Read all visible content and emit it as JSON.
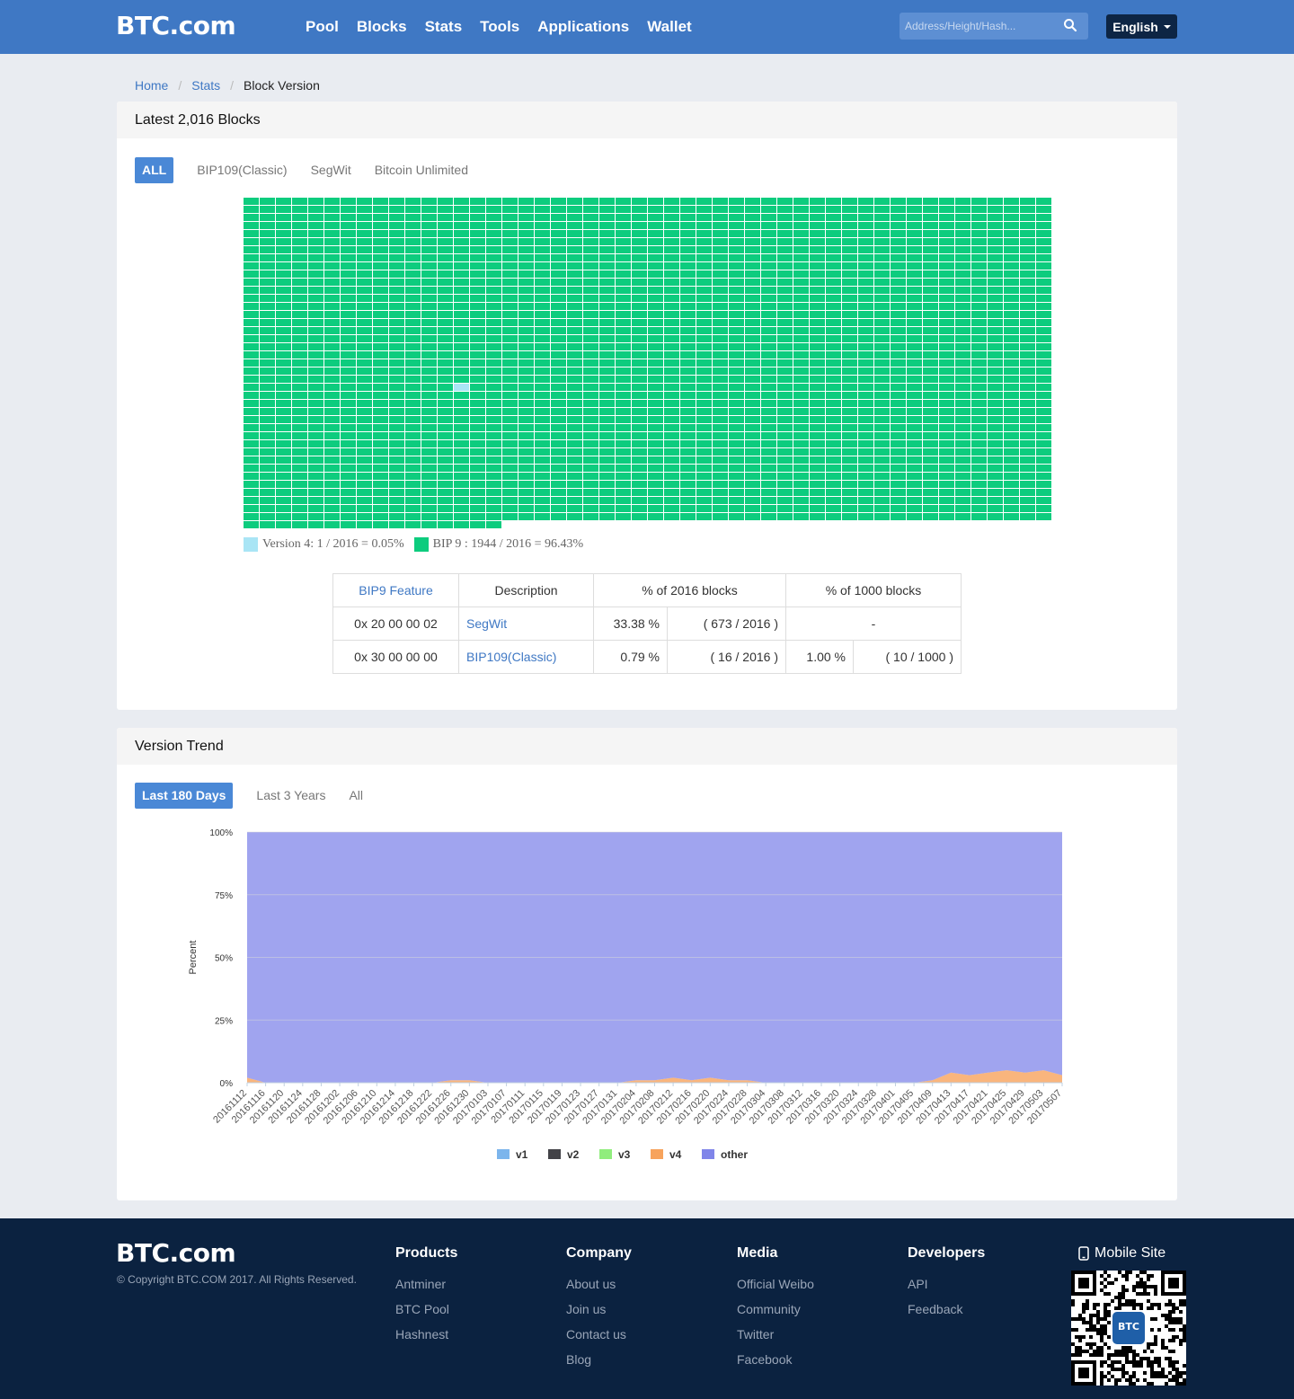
{
  "nav": {
    "logo": "BTC.com",
    "links": [
      "Pool",
      "Blocks",
      "Stats",
      "Tools",
      "Applications",
      "Wallet"
    ],
    "search_placeholder": "Address/Height/Hash...",
    "language": "English"
  },
  "breadcrumb": [
    "Home",
    "Stats",
    "Block Version"
  ],
  "blocks_panel": {
    "title": "Latest 2,016 Blocks",
    "tabs": [
      "ALL",
      "BIP109(Classic)",
      "SegWit",
      "Bitcoin Unlimited"
    ],
    "active_tab": "ALL",
    "legend": [
      {
        "label": "Version 4: 1 / 2016 = 0.05%",
        "color": "#a9e5f5"
      },
      {
        "label": "BIP 9 : 1944 / 2016 = 96.43%",
        "color": "#0dcc7e"
      }
    ],
    "grid_colors": {
      "bip9": "#0dcc7e",
      "v4": "#a9e5f5"
    },
    "table": {
      "headers": [
        "BIP9 Feature",
        "Description",
        "% of 2016 blocks",
        "% of 1000 blocks"
      ],
      "rows": [
        {
          "feature": "0x 20 00 00 02",
          "desc": "SegWit",
          "pct2016": "33.38 %",
          "cnt2016": "( 673 / 2016 )",
          "pct1000": "-",
          "cnt1000": ""
        },
        {
          "feature": "0x 30 00 00 00",
          "desc": "BIP109(Classic)",
          "pct2016": "0.79 %",
          "cnt2016": "( 16 / 2016 )",
          "pct1000": "1.00 %",
          "cnt1000": "( 10 / 1000 )"
        }
      ]
    }
  },
  "trend_panel": {
    "title": "Version Trend",
    "tabs": [
      "Last 180 Days",
      "Last 3 Years",
      "All"
    ],
    "active_tab": "Last 180 Days"
  },
  "chart_data": {
    "type": "area",
    "stacked": true,
    "ylabel": "Percent",
    "yticks": [
      "0%",
      "25%",
      "50%",
      "75%",
      "100%"
    ],
    "ylim": [
      0,
      100
    ],
    "x": [
      "20161112",
      "20161116",
      "20161120",
      "20161124",
      "20161128",
      "20161202",
      "20161206",
      "20161210",
      "20161214",
      "20161218",
      "20161222",
      "20161226",
      "20161230",
      "20170103",
      "20170107",
      "20170111",
      "20170115",
      "20170119",
      "20170123",
      "20170127",
      "20170131",
      "20170204",
      "20170208",
      "20170212",
      "20170216",
      "20170220",
      "20170224",
      "20170228",
      "20170304",
      "20170308",
      "20170312",
      "20170316",
      "20170320",
      "20170324",
      "20170328",
      "20170401",
      "20170405",
      "20170409",
      "20170413",
      "20170417",
      "20170421",
      "20170425",
      "20170429",
      "20170503",
      "20170507"
    ],
    "series": [
      {
        "name": "v1",
        "color": "#7cb5ec",
        "values": [
          0,
          0,
          0,
          0,
          0,
          0,
          0,
          0,
          0,
          0,
          0,
          0,
          0,
          0,
          0,
          0,
          0,
          0,
          0,
          0,
          0,
          0,
          0,
          0,
          0,
          0,
          0,
          0,
          0,
          0,
          0,
          0,
          0,
          0,
          0,
          0,
          0,
          0,
          0,
          0,
          0,
          0,
          0,
          0,
          0
        ]
      },
      {
        "name": "v2",
        "color": "#434348",
        "values": [
          0,
          0,
          0,
          0,
          0,
          0,
          0,
          0,
          0,
          0,
          0,
          0,
          0,
          0,
          0,
          0,
          0,
          0,
          0,
          0,
          0,
          0,
          0,
          0,
          0,
          0,
          0,
          0,
          0,
          0,
          0,
          0,
          0,
          0,
          0,
          0,
          0,
          0,
          0,
          0,
          0,
          0,
          0,
          0,
          0
        ]
      },
      {
        "name": "v3",
        "color": "#90ed7d",
        "values": [
          0,
          0,
          0,
          0,
          0,
          0,
          0,
          0,
          0,
          0,
          0,
          0,
          0,
          0,
          0,
          0,
          0,
          0,
          0,
          0,
          0,
          0,
          0,
          0,
          0,
          0,
          0,
          0,
          0,
          0,
          0,
          0,
          0,
          0,
          0,
          0,
          0,
          0,
          0,
          0,
          0,
          0,
          0,
          0,
          0
        ]
      },
      {
        "name": "v4",
        "color": "#f7a35c",
        "values": [
          2,
          0,
          0,
          0,
          0,
          0,
          0,
          0,
          0,
          0,
          0,
          1,
          1,
          0,
          0,
          0,
          0,
          0,
          0,
          0,
          0,
          1,
          1,
          2,
          1,
          2,
          1,
          1,
          0,
          0,
          0,
          0,
          0,
          0,
          0,
          0,
          0,
          1,
          4,
          3,
          4,
          5,
          4,
          5,
          3
        ]
      },
      {
        "name": "other",
        "color": "#8085e9",
        "values": [
          98,
          100,
          100,
          100,
          100,
          100,
          100,
          100,
          100,
          100,
          100,
          99,
          99,
          100,
          100,
          100,
          100,
          100,
          100,
          100,
          100,
          99,
          99,
          98,
          99,
          98,
          99,
          99,
          100,
          100,
          100,
          100,
          100,
          100,
          100,
          100,
          100,
          99,
          96,
          97,
          96,
          95,
          96,
          95,
          97
        ]
      }
    ]
  },
  "footer": {
    "logo": "BTC.com",
    "copyright": "© Copyright BTC.COM 2017. All Rights Reserved.",
    "columns": [
      {
        "title": "Products",
        "items": [
          "Antminer",
          "BTC Pool",
          "Hashnest"
        ]
      },
      {
        "title": "Company",
        "items": [
          "About us",
          "Join us",
          "Contact us",
          "Blog"
        ]
      },
      {
        "title": "Media",
        "items": [
          "Official Weibo",
          "Community",
          "Twitter",
          "Facebook"
        ]
      },
      {
        "title": "Developers",
        "items": [
          "API",
          "Feedback"
        ]
      }
    ],
    "mobile": "Mobile Site",
    "qr_badge": "BTC"
  }
}
